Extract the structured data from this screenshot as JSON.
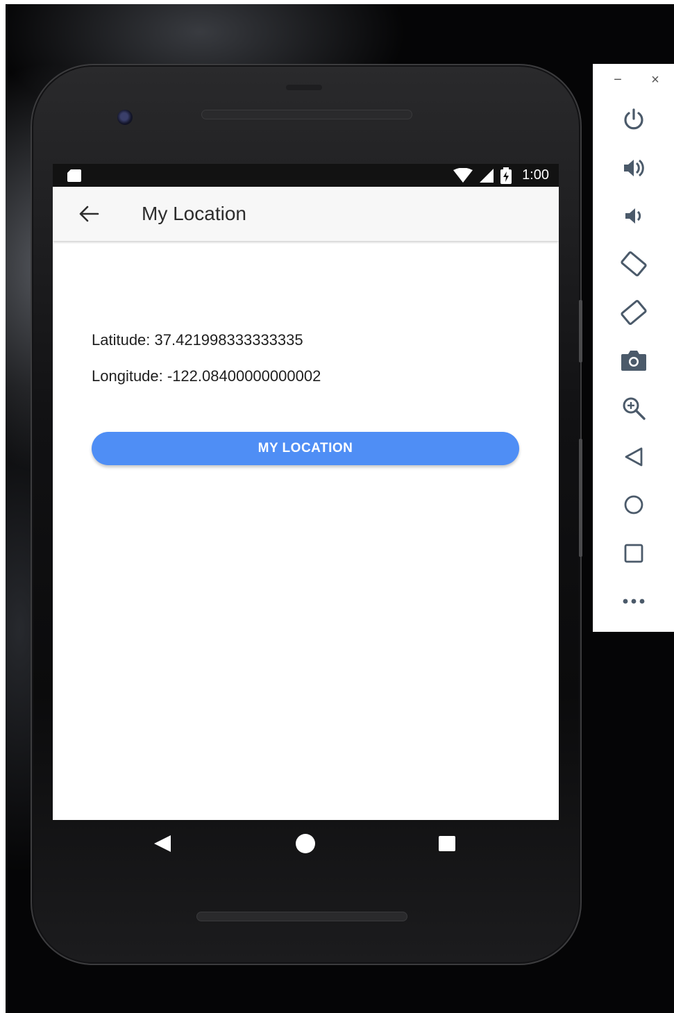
{
  "status_bar": {
    "time": "1:00",
    "icons": [
      "sd-card-icon",
      "wifi-icon",
      "signal-icon",
      "battery-charging-icon"
    ]
  },
  "app_bar": {
    "title": "My Location",
    "back_icon": "arrow-back-icon"
  },
  "location": {
    "latitude_text": "Latitude: 37.421998333333335",
    "longitude_text": "Longitude: -122.08400000000002"
  },
  "button": {
    "label": "MY LOCATION",
    "color": "#4f8ef5"
  },
  "nav_bar": {
    "icons": [
      "back-triangle-icon",
      "home-circle-icon",
      "recents-square-icon"
    ]
  },
  "emulator_panel": {
    "window_controls": {
      "minimize": "−",
      "close": "×"
    },
    "tools": [
      "power-icon",
      "volume-up-icon",
      "volume-down-icon",
      "rotate-left-icon",
      "rotate-right-icon",
      "camera-icon",
      "zoom-icon",
      "back-icon",
      "home-icon",
      "overview-icon",
      "more-icon"
    ]
  }
}
